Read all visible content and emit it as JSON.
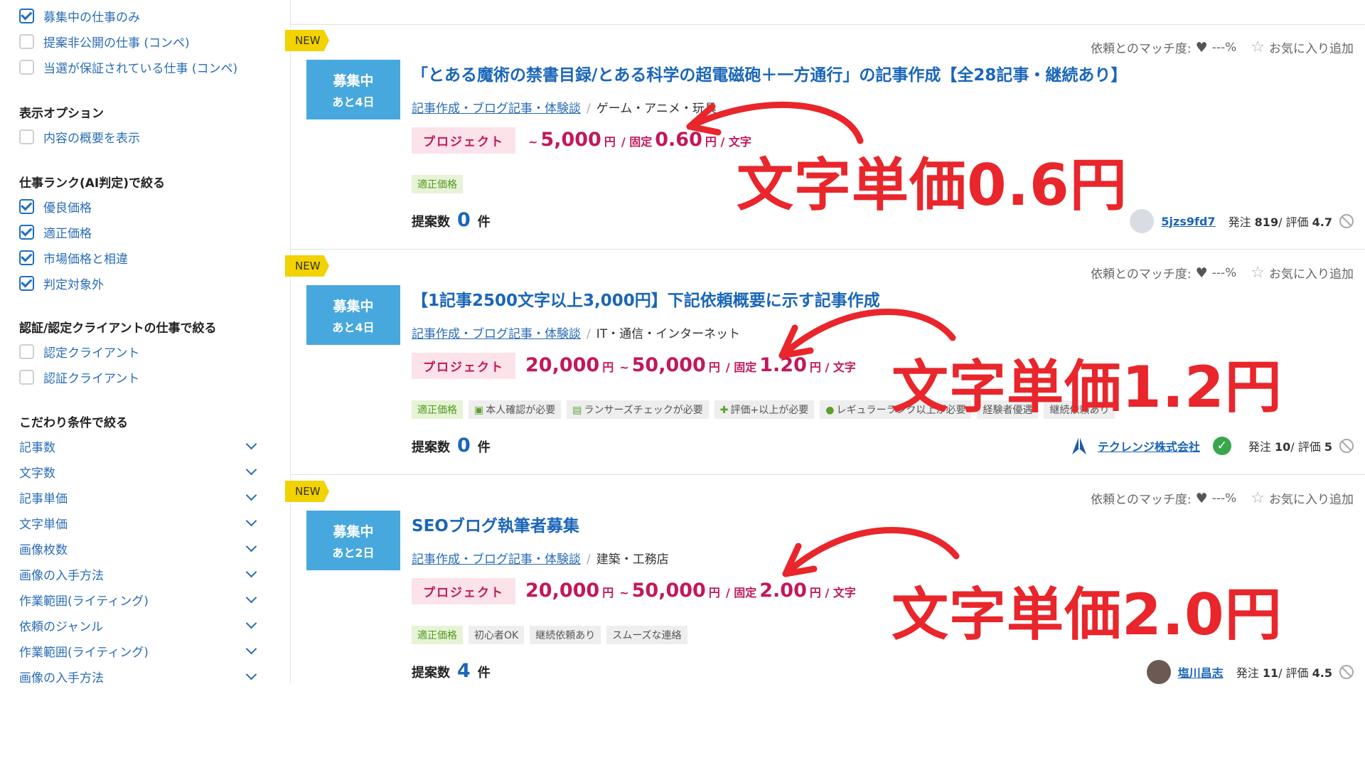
{
  "sidebar": {
    "top_filters": [
      {
        "label": "募集中の仕事のみ",
        "checked": true
      },
      {
        "label": "提案非公開の仕事 (コンペ)",
        "checked": false
      },
      {
        "label": "当選が保証されている仕事 (コンペ)",
        "checked": false
      }
    ],
    "display_options": {
      "heading": "表示オプション",
      "items": [
        {
          "label": "内容の概要を表示",
          "checked": false
        }
      ]
    },
    "job_rank": {
      "heading": "仕事ランク(AI判定)で絞る",
      "items": [
        {
          "label": "優良価格",
          "checked": true
        },
        {
          "label": "適正価格",
          "checked": true
        },
        {
          "label": "市場価格と相違",
          "checked": true
        },
        {
          "label": "判定対象外",
          "checked": true
        }
      ]
    },
    "certified": {
      "heading": "認証/認定クライアントの仕事で絞る",
      "items": [
        {
          "label": "認定クライアント",
          "checked": false
        },
        {
          "label": "認証クライアント",
          "checked": false
        }
      ]
    },
    "conditions": {
      "heading": "こだわり条件で絞る",
      "items": [
        "記事数",
        "文字数",
        "記事単価",
        "文字単価",
        "画像枚数",
        "画像の入手方法",
        "作業範囲(ライティング)",
        "依頼のジャンル",
        "作業範囲(ライティング)",
        "画像の入手方法"
      ]
    }
  },
  "common": {
    "new_label": "NEW",
    "status_main": "募集中",
    "match_label": "依頼とのマッチ度:",
    "match_value": "---%",
    "favorite_label": "お気に入り追加",
    "project_label": "プロジェクト",
    "yen": "円",
    "tilde": "~",
    "fixed": "/ 固定",
    "per_char": "円 / 文字",
    "proposals_label": "提案数",
    "proposals_unit": "件",
    "order_prefix": "発注",
    "rating_prefix": "/ 評価",
    "category_sep": "/"
  },
  "jobs": [
    {
      "status_sub": "あと4日",
      "title": "「とある魔術の禁書目録/とある科学の超電磁砲＋一方通行」の記事作成【全28記事・継続あり】",
      "category_link": "記事作成・ブログ記事・体験談",
      "category_text": "ゲーム・アニメ・玩具",
      "price_min": "",
      "price_max": "5,000",
      "unit_price": "0.60",
      "tags": [
        {
          "label": "適正価格",
          "style": "green"
        }
      ],
      "proposals": "0",
      "client_name": "5jzs9fd7",
      "orders": "819",
      "rating": "4.7",
      "annotation": "文字単価0.6円"
    },
    {
      "status_sub": "あと4日",
      "title": "【1記事2500文字以上3,000円】下記依頼概要に示す記事作成",
      "category_link": "記事作成・ブログ記事・体験談",
      "category_text": "IT・通信・インターネット",
      "price_min": "20,000",
      "price_max": "50,000",
      "unit_price": "1.20",
      "tags": [
        {
          "label": "適正価格",
          "style": "green"
        },
        {
          "label": "本人確認が必要",
          "style": "plain",
          "icon": "id-card-icon"
        },
        {
          "label": "ランサーズチェックが必要",
          "style": "plain",
          "icon": "clipboard-icon"
        },
        {
          "label": "評価+以上が必要",
          "style": "plain",
          "icon": "user-plus-icon"
        },
        {
          "label": "レギュラーランク以上が必要",
          "style": "plain",
          "icon": "user-lock-icon"
        },
        {
          "label": "経験者優遇",
          "style": "plain"
        },
        {
          "label": "継続依頼あり",
          "style": "plain"
        }
      ],
      "proposals": "0",
      "client_name": "テクレンジ株式会社",
      "orders": "10",
      "rating": "5",
      "annotation": "文字単価1.2円"
    },
    {
      "status_sub": "あと2日",
      "title": "SEOブログ執筆者募集",
      "category_link": "記事作成・ブログ記事・体験談",
      "category_text": "建築・工務店",
      "price_min": "20,000",
      "price_max": "50,000",
      "unit_price": "2.00",
      "tags": [
        {
          "label": "適正価格",
          "style": "green"
        },
        {
          "label": "初心者OK",
          "style": "plain"
        },
        {
          "label": "継続依頼あり",
          "style": "plain"
        },
        {
          "label": "スムーズな連絡",
          "style": "plain"
        }
      ],
      "proposals": "4",
      "client_name": "塩川昌志",
      "orders": "11",
      "rating": "4.5",
      "annotation": "文字単価2.0円"
    }
  ],
  "colors": {
    "annotation_red": "#e8262b",
    "status_blue": "#47a8de",
    "link_blue": "#1a66b8",
    "price_pink": "#c2185b",
    "new_yellow": "#f2d200"
  }
}
